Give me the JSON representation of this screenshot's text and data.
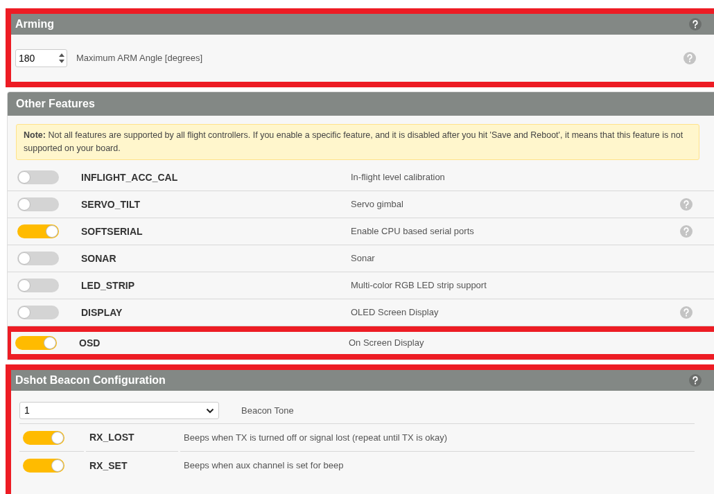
{
  "arming": {
    "title": "Arming",
    "highlighted": true,
    "header_help": true,
    "angle": {
      "value": "180",
      "label": "Maximum ARM Angle [degrees]",
      "help": true
    }
  },
  "other_features": {
    "title": "Other Features",
    "note": "**Note:** Not all features are supported by all flight controllers. If you enable a specific feature, and it is disabled after you hit 'Save and Reboot', it means that this feature is not supported on your board.",
    "features": [
      {
        "name": "INFLIGHT_ACC_CAL",
        "description": "In-flight level calibration",
        "on": false,
        "help": false,
        "highlighted": false
      },
      {
        "name": "SERVO_TILT",
        "description": "Servo gimbal",
        "on": false,
        "help": true,
        "highlighted": false
      },
      {
        "name": "SOFTSERIAL",
        "description": "Enable CPU based serial ports",
        "on": true,
        "help": true,
        "highlighted": false
      },
      {
        "name": "SONAR",
        "description": "Sonar",
        "on": false,
        "help": false,
        "highlighted": false
      },
      {
        "name": "LED_STRIP",
        "description": "Multi-color RGB LED strip support",
        "on": false,
        "help": false,
        "highlighted": false
      },
      {
        "name": "DISPLAY",
        "description": "OLED Screen Display",
        "on": false,
        "help": true,
        "highlighted": false
      },
      {
        "name": "OSD",
        "description": "On Screen Display",
        "on": true,
        "help": false,
        "highlighted": true
      }
    ]
  },
  "dshot_beacon": {
    "title": "Dshot Beacon Configuration",
    "highlighted": true,
    "header_help": true,
    "tone": {
      "value": "1",
      "label": "Beacon Tone"
    },
    "conditions": [
      {
        "name": "RX_LOST",
        "description": "Beeps when TX is turned off or signal lost (repeat until TX is okay)",
        "on": true
      },
      {
        "name": "RX_SET",
        "description": "Beeps when aux channel is set for beep",
        "on": true
      }
    ]
  }
}
